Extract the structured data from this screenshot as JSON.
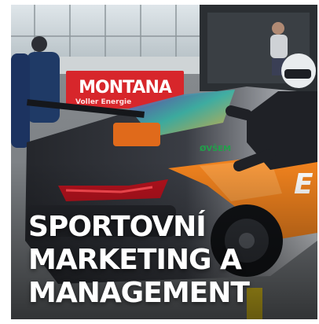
{
  "banner": {
    "brand": "MONTANA",
    "tagline": "Voller Energie"
  },
  "car": {
    "sponsor_logo": "ØVŠEM",
    "side_lettering": "E"
  },
  "headline": {
    "lines": [
      "SPORTOVNÍ",
      "MARKETING A",
      "MANAGEMENT"
    ]
  },
  "colors": {
    "banner_red": "#d7262b",
    "car_orange": "#f0821e",
    "car_gray": "#c9ccd0",
    "text_white": "#ffffff"
  }
}
